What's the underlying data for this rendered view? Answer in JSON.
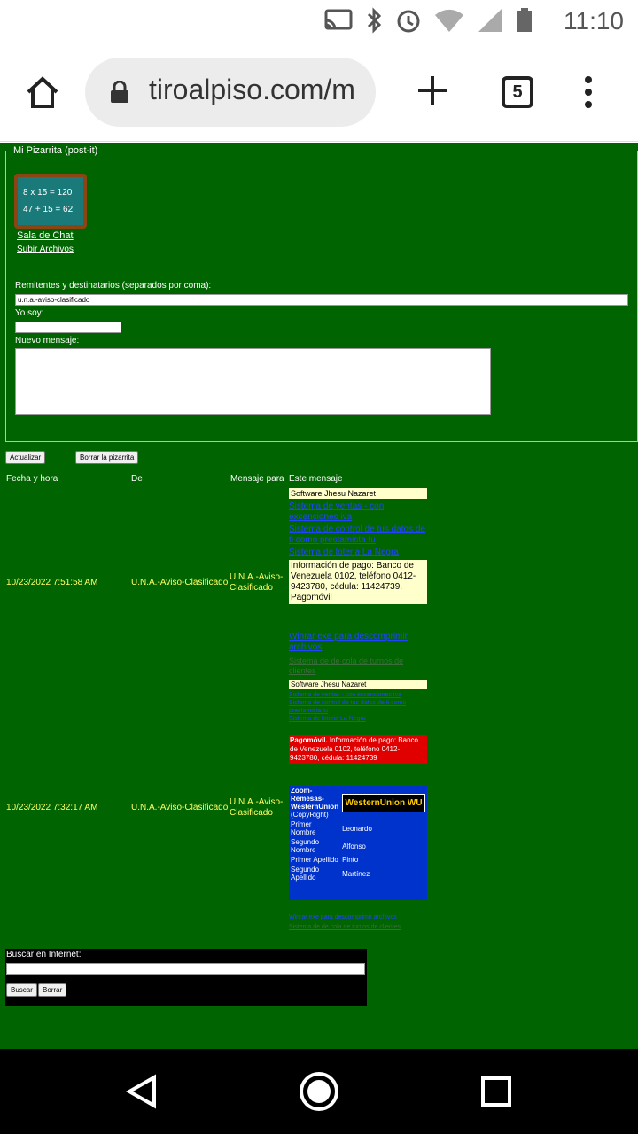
{
  "status": {
    "time": "11:10"
  },
  "browser": {
    "url": "tiroalpiso.com/m",
    "tab_count": "5"
  },
  "pizarra": {
    "legend": "Mi Pizarrita (post-it)",
    "board_line1": "8 x 15 = 120",
    "board_line2": "47 + 15 = 62",
    "chat_link": "Sala de Chat",
    "upload_link": "Subir Archivos",
    "recipients_label": "Remitentes y destinatarios (separados por coma):",
    "recipients_value": "u.n.a.-aviso-clasificado",
    "yo_soy_label": "Yo soy:",
    "nuevo_label": "Nuevo mensaje:",
    "actualizar": "Actualizar",
    "borrar": "Borrar la pizarrita"
  },
  "table": {
    "headers": [
      "Fecha y hora",
      "De",
      "Mensaje para",
      "Este mensaje"
    ],
    "rows": [
      {
        "date": "10/23/2022 7:51:58 AM",
        "from": "U.N.A.-Aviso-Clasificado",
        "to": "U.N.A.-Aviso-Clasificado"
      },
      {
        "date": "10/23/2022 7:32:17 AM",
        "from": "U.N.A.-Aviso-Clasificado",
        "to": "U.N.A.-Aviso-Clasificado"
      }
    ]
  },
  "msg1": {
    "title": "Software Jhesu Nazaret",
    "link1": "Sistema de ventas - con excenciones iva",
    "link2": "Sistema de control de tus datos de ti como prestamista tu",
    "link3": "Sistema de loteria La Negra",
    "payment": "Información de pago: Banco de Venezuela 0102, teléfono 0412-9423780, cédula: 11424739. Pagomóvil"
  },
  "msg2": {
    "winrar": "Winrar exe para descomprimir archivos",
    "gray": "Sistema de de cola de turnos de clientes",
    "title": "Software Jhesu Nazaret",
    "link1": "Sistema de ventas - con excenciones iva",
    "link2": "Sistema de control de tus datos de ti como prestamista tu",
    "link3": "Sistema de loteria La Negra",
    "pago_bold": "Pagomóvil.",
    "pago": "Información de pago: Banco de Venezuela 0102, teléfono 0412-9423780, cédula: 11424739",
    "wu_title": "Zoom-Remesas-WesternUnion",
    "wu_copy": "(CopyRight)",
    "wu_logo": "WesternUnion WU",
    "fields": [
      {
        "label": "Primer Nombre",
        "value": "Leonardo"
      },
      {
        "label": "Segundo Nombre",
        "value": "Alfonso"
      },
      {
        "label": "Primer Apellido",
        "value": "Pinto"
      },
      {
        "label": "Segundo Apellido",
        "value": "Martínez"
      }
    ],
    "winrar2": "Winrar exe para descomprimir archivos",
    "gray2": "Sistema de de cola de turnos de clientes"
  },
  "search": {
    "label": "Buscar en Internet:",
    "buscar": "Buscar",
    "borrar": "Borrar"
  },
  "colors": {
    "page_bg": "#006400",
    "accent_yellow": "#ffff66"
  }
}
